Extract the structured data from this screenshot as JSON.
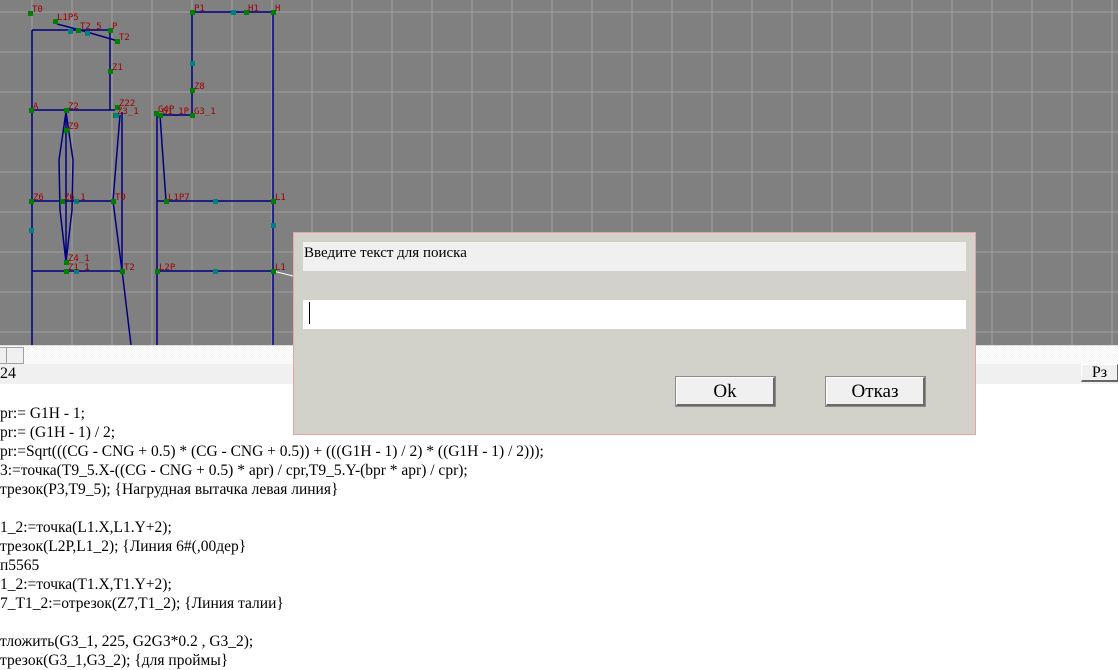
{
  "canvas": {
    "labels": [
      "T0",
      "L1P5",
      "T2_5",
      "P",
      "T2",
      "Z1",
      "A",
      "Z2",
      "Z22",
      "Z3_1",
      "G4P",
      "G1_1P",
      "G3_1",
      "P1",
      "H1",
      "H",
      "Z8",
      "Z9",
      "Z6_1",
      "T9",
      "L1P7",
      "L1",
      "Z4_1",
      "Z1_1",
      "T2",
      "L2P",
      "L1",
      "Z6"
    ],
    "colors": {
      "background": "#808080",
      "grid": "#a0a0a0",
      "line": "#000080",
      "point": "#008000",
      "midpoint": "#008080",
      "label": "#a00000"
    }
  },
  "status": {
    "line_number": "24",
    "right_button": "Рз"
  },
  "code_lines": [
    "pr:= G1H - 1;",
    "pr:= (G1H - 1) / 2;",
    "pr:=Sqrt(((CG - CNG + 0.5) * (CG - CNG + 0.5)) + (((G1H - 1) / 2) * ((G1H - 1) / 2)));",
    "3:=точка(T9_5.X-((CG - CNG + 0.5) * apr) / cpr,T9_5.Y-(bpr * apr) / cpr);",
    "трезок(P3,T9_5); {Нагрудная вытачка левая линия}",
    "",
    "1_2:=точка(L1.X,L1.Y+2);",
    "трезок(L2P,L1_2); {Линия 6#(,00дер}",
    "п5565",
    "1_2:=точка(T1.X,T1.Y+2);",
    "7_T1_2:=отрезок(Z7,T1_2); {Линия талии}",
    "",
    "тложить(G3_1, 225, G2G3*0.2 , G3_2);",
    "трезок(G3_1,G3_2); {для проймы}"
  ],
  "dialog": {
    "prompt": "Введите текст для поиска",
    "input_value": "",
    "ok_label": "Ok",
    "cancel_label": "Отказ"
  }
}
